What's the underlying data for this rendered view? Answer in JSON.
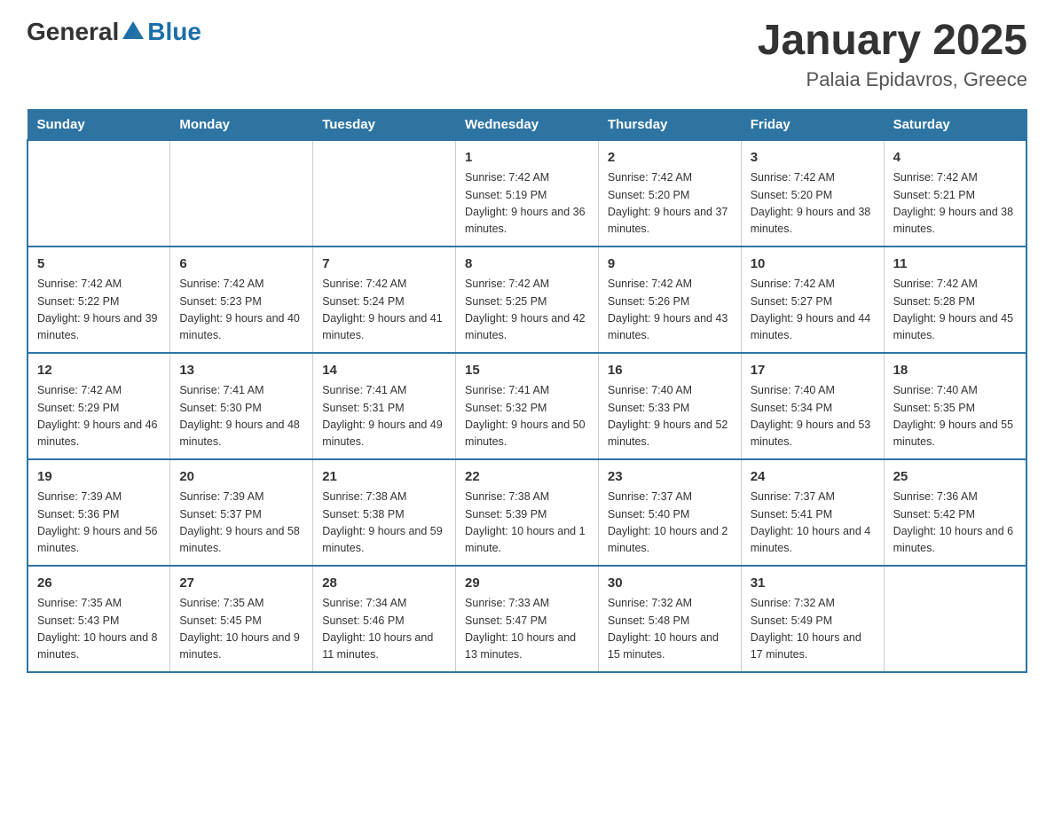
{
  "header": {
    "logo_general": "General",
    "logo_blue": "Blue",
    "title": "January 2025",
    "subtitle": "Palaia Epidavros, Greece"
  },
  "days_of_week": [
    "Sunday",
    "Monday",
    "Tuesday",
    "Wednesday",
    "Thursday",
    "Friday",
    "Saturday"
  ],
  "weeks": [
    [
      {
        "day": "",
        "info": ""
      },
      {
        "day": "",
        "info": ""
      },
      {
        "day": "",
        "info": ""
      },
      {
        "day": "1",
        "info": "Sunrise: 7:42 AM\nSunset: 5:19 PM\nDaylight: 9 hours and 36 minutes."
      },
      {
        "day": "2",
        "info": "Sunrise: 7:42 AM\nSunset: 5:20 PM\nDaylight: 9 hours and 37 minutes."
      },
      {
        "day": "3",
        "info": "Sunrise: 7:42 AM\nSunset: 5:20 PM\nDaylight: 9 hours and 38 minutes."
      },
      {
        "day": "4",
        "info": "Sunrise: 7:42 AM\nSunset: 5:21 PM\nDaylight: 9 hours and 38 minutes."
      }
    ],
    [
      {
        "day": "5",
        "info": "Sunrise: 7:42 AM\nSunset: 5:22 PM\nDaylight: 9 hours and 39 minutes."
      },
      {
        "day": "6",
        "info": "Sunrise: 7:42 AM\nSunset: 5:23 PM\nDaylight: 9 hours and 40 minutes."
      },
      {
        "day": "7",
        "info": "Sunrise: 7:42 AM\nSunset: 5:24 PM\nDaylight: 9 hours and 41 minutes."
      },
      {
        "day": "8",
        "info": "Sunrise: 7:42 AM\nSunset: 5:25 PM\nDaylight: 9 hours and 42 minutes."
      },
      {
        "day": "9",
        "info": "Sunrise: 7:42 AM\nSunset: 5:26 PM\nDaylight: 9 hours and 43 minutes."
      },
      {
        "day": "10",
        "info": "Sunrise: 7:42 AM\nSunset: 5:27 PM\nDaylight: 9 hours and 44 minutes."
      },
      {
        "day": "11",
        "info": "Sunrise: 7:42 AM\nSunset: 5:28 PM\nDaylight: 9 hours and 45 minutes."
      }
    ],
    [
      {
        "day": "12",
        "info": "Sunrise: 7:42 AM\nSunset: 5:29 PM\nDaylight: 9 hours and 46 minutes."
      },
      {
        "day": "13",
        "info": "Sunrise: 7:41 AM\nSunset: 5:30 PM\nDaylight: 9 hours and 48 minutes."
      },
      {
        "day": "14",
        "info": "Sunrise: 7:41 AM\nSunset: 5:31 PM\nDaylight: 9 hours and 49 minutes."
      },
      {
        "day": "15",
        "info": "Sunrise: 7:41 AM\nSunset: 5:32 PM\nDaylight: 9 hours and 50 minutes."
      },
      {
        "day": "16",
        "info": "Sunrise: 7:40 AM\nSunset: 5:33 PM\nDaylight: 9 hours and 52 minutes."
      },
      {
        "day": "17",
        "info": "Sunrise: 7:40 AM\nSunset: 5:34 PM\nDaylight: 9 hours and 53 minutes."
      },
      {
        "day": "18",
        "info": "Sunrise: 7:40 AM\nSunset: 5:35 PM\nDaylight: 9 hours and 55 minutes."
      }
    ],
    [
      {
        "day": "19",
        "info": "Sunrise: 7:39 AM\nSunset: 5:36 PM\nDaylight: 9 hours and 56 minutes."
      },
      {
        "day": "20",
        "info": "Sunrise: 7:39 AM\nSunset: 5:37 PM\nDaylight: 9 hours and 58 minutes."
      },
      {
        "day": "21",
        "info": "Sunrise: 7:38 AM\nSunset: 5:38 PM\nDaylight: 9 hours and 59 minutes."
      },
      {
        "day": "22",
        "info": "Sunrise: 7:38 AM\nSunset: 5:39 PM\nDaylight: 10 hours and 1 minute."
      },
      {
        "day": "23",
        "info": "Sunrise: 7:37 AM\nSunset: 5:40 PM\nDaylight: 10 hours and 2 minutes."
      },
      {
        "day": "24",
        "info": "Sunrise: 7:37 AM\nSunset: 5:41 PM\nDaylight: 10 hours and 4 minutes."
      },
      {
        "day": "25",
        "info": "Sunrise: 7:36 AM\nSunset: 5:42 PM\nDaylight: 10 hours and 6 minutes."
      }
    ],
    [
      {
        "day": "26",
        "info": "Sunrise: 7:35 AM\nSunset: 5:43 PM\nDaylight: 10 hours and 8 minutes."
      },
      {
        "day": "27",
        "info": "Sunrise: 7:35 AM\nSunset: 5:45 PM\nDaylight: 10 hours and 9 minutes."
      },
      {
        "day": "28",
        "info": "Sunrise: 7:34 AM\nSunset: 5:46 PM\nDaylight: 10 hours and 11 minutes."
      },
      {
        "day": "29",
        "info": "Sunrise: 7:33 AM\nSunset: 5:47 PM\nDaylight: 10 hours and 13 minutes."
      },
      {
        "day": "30",
        "info": "Sunrise: 7:32 AM\nSunset: 5:48 PM\nDaylight: 10 hours and 15 minutes."
      },
      {
        "day": "31",
        "info": "Sunrise: 7:32 AM\nSunset: 5:49 PM\nDaylight: 10 hours and 17 minutes."
      },
      {
        "day": "",
        "info": ""
      }
    ]
  ]
}
